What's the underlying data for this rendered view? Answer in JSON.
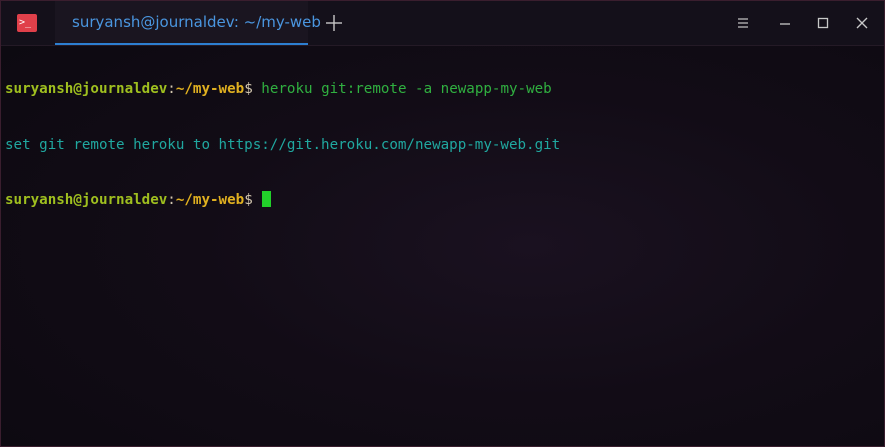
{
  "window": {
    "tab_title": "suryansh@journaldev: ~/my-web",
    "app_icon_glyph": ">_",
    "icons": {
      "app": "terminal-icon",
      "new_tab": "plus-icon",
      "menu": "hamburger-menu-icon",
      "minimize": "minimize-icon",
      "maximize": "maximize-icon",
      "close": "close-icon"
    }
  },
  "terminal": {
    "prompt": {
      "user": "suryansh@journaldev",
      "colon": ":",
      "path": "~/my-web",
      "dollar": "$"
    },
    "line1_command": " heroku git:remote -a newapp-my-web",
    "line2_output": "set git remote heroku to https://git.heroku.com/newapp-my-web.git",
    "line3_command": " "
  },
  "colors": {
    "accent": "#2d7fd1",
    "user": "#9fbf1f",
    "path": "#e0b020",
    "command": "#30b040",
    "output": "#20a8a0",
    "cursor": "#22d02a",
    "app_icon": "#e0404a"
  }
}
